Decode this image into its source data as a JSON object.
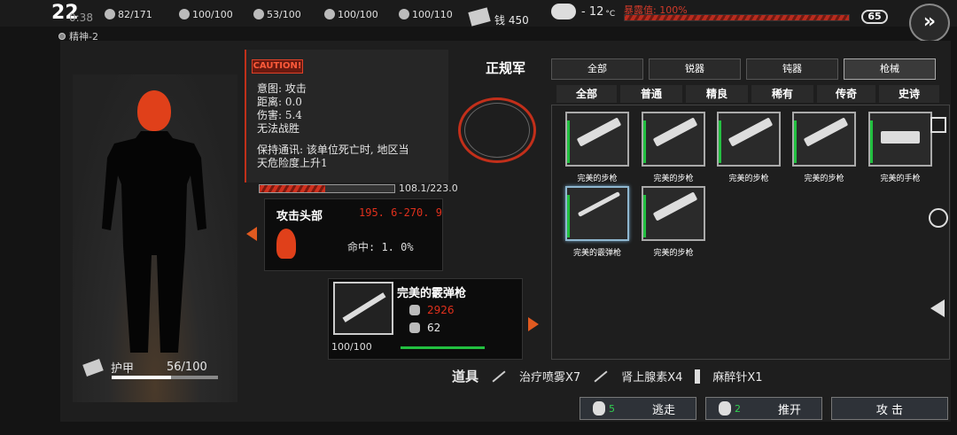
{
  "status": {
    "clock": "22",
    "clock_sub": "0:38",
    "stats": [
      {
        "icon": "food-icon",
        "text": "82/171"
      },
      {
        "icon": "water-icon",
        "text": "100/100"
      },
      {
        "icon": "temperature-icon",
        "text": "53/100"
      },
      {
        "icon": "health-icon",
        "text": "100/100"
      },
      {
        "icon": "fatigue-icon",
        "text": "100/110"
      }
    ],
    "money_label": "钱 450",
    "weather_temp": "- 12",
    "weather_unit": "°C",
    "exposure_label": "暴露值: 100%",
    "exposure_value": 1.0,
    "level": "65",
    "spirit": "精神-2",
    "fast_forward": "»"
  },
  "enemy": {
    "caution_tag": "CAUTION!",
    "name": "正规军",
    "lines": [
      "意图: 攻击",
      "距离: 0.0",
      "伤害: 5.4",
      "无法战胜",
      "保持通讯: 该单位死亡时, 地区当",
      "天危险度上升1"
    ],
    "hp_text": "108.1/223.0",
    "hp_fraction": 0.485
  },
  "target": {
    "title": "攻击头部",
    "damage": "195. 6-270. 9",
    "hit": "命中: 1. 0%"
  },
  "weapon": {
    "name": "完美的霰弹枪",
    "stat1": "2926",
    "stat2": "62",
    "ammo": "100/100"
  },
  "armor": {
    "label": "护甲",
    "value": "56/100",
    "fraction": 0.56
  },
  "tabs_top": [
    "全部",
    "锐器",
    "钝器",
    "枪械"
  ],
  "tabs_quality": [
    "全部",
    "普通",
    "精良",
    "稀有",
    "传奇",
    "史诗"
  ],
  "items": [
    {
      "label": "完美的步枪",
      "icon": "rifle-icon"
    },
    {
      "label": "完美的步枪",
      "icon": "rifle-icon"
    },
    {
      "label": "完美的步枪",
      "icon": "rifle-icon"
    },
    {
      "label": "完美的步枪",
      "icon": "rifle-icon"
    },
    {
      "label": "完美的手枪",
      "icon": "pistol-icon"
    },
    {
      "label": "完美的霰弹枪",
      "icon": "shotgun-icon"
    },
    {
      "label": "完美的步枪",
      "icon": "rifle-icon"
    }
  ],
  "tools": {
    "label": "道具",
    "items": [
      "治疗喷雾X7",
      "肾上腺素X4",
      "麻醉针X1"
    ]
  },
  "actions": {
    "escape": "逃走",
    "escape_count": "5",
    "push": "推开",
    "push_count": "2",
    "attack": "攻 击"
  }
}
